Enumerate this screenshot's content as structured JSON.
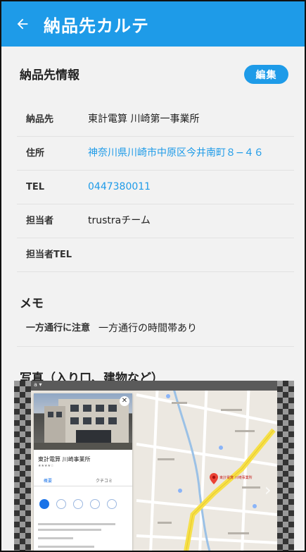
{
  "app_bar": {
    "back_icon": "arrow-left-icon",
    "title": "納品先カルテ"
  },
  "delivery_info": {
    "title": "納品先情報",
    "edit_label": "編集",
    "rows": [
      {
        "label": "納品先",
        "value": "東計電算 川崎第一事業所",
        "link": false
      },
      {
        "label": "住所",
        "value": "神奈川県川崎市中原区今井南町８−４６",
        "link": true
      },
      {
        "label": "TEL",
        "value": "0447380011",
        "link": true
      },
      {
        "label": "担当者",
        "value": "trustraチーム",
        "link": false
      },
      {
        "label": "担当者TEL",
        "value": "",
        "link": false
      }
    ]
  },
  "memo": {
    "title": "メモ",
    "label": "一方通行に注意",
    "value": "一方通行の時間帯あり"
  },
  "photos": {
    "title": "写真（入り口、建物など）",
    "map_card_name": "東計電算 川崎事業所",
    "map_card_tab_1": "概要",
    "map_card_tab_2": "クチコミ",
    "map_pin_label": "東計電算 川崎事業所"
  },
  "colors": {
    "accent": "#1e9be8",
    "background": "#f2f2f2",
    "map_road": "#f6e04a"
  }
}
